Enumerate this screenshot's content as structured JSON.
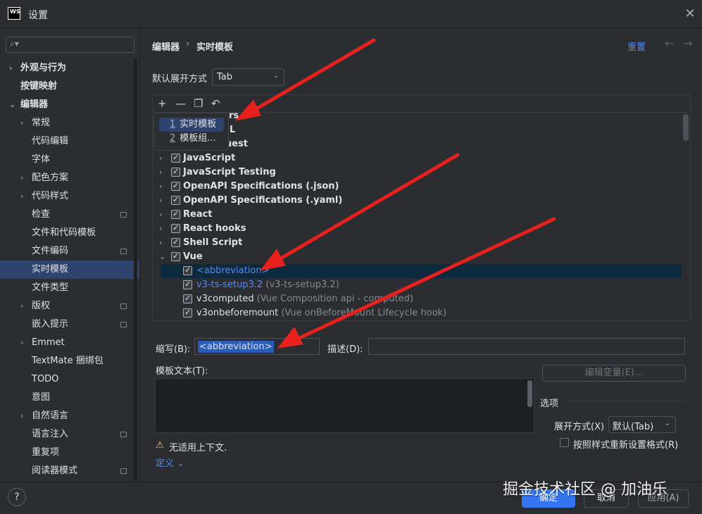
{
  "window": {
    "title": "设置",
    "logo": "WS"
  },
  "sidebar": {
    "search_placeholder": "",
    "items": [
      {
        "label": "外观与行为",
        "bold": true,
        "chevron": "›"
      },
      {
        "label": "按键映射",
        "bold": true,
        "chevron": ""
      },
      {
        "label": "编辑器",
        "bold": true,
        "chevron": "⌄"
      },
      {
        "label": "常规",
        "chevron": "›"
      },
      {
        "label": "代码编辑"
      },
      {
        "label": "字体"
      },
      {
        "label": "配色方案",
        "chevron": "›"
      },
      {
        "label": "代码样式",
        "chevron": "›"
      },
      {
        "label": "检查",
        "badge": true
      },
      {
        "label": "文件和代码模板"
      },
      {
        "label": "文件编码",
        "badge": true
      },
      {
        "label": "实时模板",
        "selected": true
      },
      {
        "label": "文件类型"
      },
      {
        "label": "版权",
        "chevron": "›",
        "badge": true
      },
      {
        "label": "嵌入提示",
        "badge": true
      },
      {
        "label": "Emmet",
        "chevron": "›"
      },
      {
        "label": "TextMate 捆绑包"
      },
      {
        "label": "TODO"
      },
      {
        "label": "意图"
      },
      {
        "label": "自然语言",
        "chevron": "›"
      },
      {
        "label": "语言注入",
        "badge": true
      },
      {
        "label": "重复项"
      },
      {
        "label": "阅读器模式",
        "badge": true
      }
    ]
  },
  "breadcrumb": {
    "parent": "编辑器",
    "separator": "›",
    "current": "实时模板"
  },
  "header": {
    "reset": "重置",
    "back_icon": "←",
    "forward_icon": "→"
  },
  "expand": {
    "label": "默认展开方式",
    "value": "Tab"
  },
  "toolbar": {
    "add_icon": "+",
    "remove_icon": "—",
    "copy_icon": "❐",
    "undo_icon": "↶"
  },
  "popup": {
    "items": [
      {
        "num": "1",
        "label": "实时模板",
        "selected": true
      },
      {
        "num": "2",
        "label": "模板组..."
      }
    ]
  },
  "tree": {
    "hidden_rows": [
      {
        "label": "rs",
        "bold": true
      },
      {
        "label": "L",
        "bold": true
      },
      {
        "label": "uest",
        "bold": true
      }
    ],
    "groups": [
      {
        "label": "JavaScript"
      },
      {
        "label": "JavaScript Testing"
      },
      {
        "label": "OpenAPI Specifications (.json)"
      },
      {
        "label": "OpenAPI Specifications (.yaml)"
      },
      {
        "label": "React"
      },
      {
        "label": "React hooks"
      },
      {
        "label": "Shell Script"
      },
      {
        "label": "Vue"
      }
    ],
    "children": [
      {
        "abbr": "<abbreviation>",
        "desc": "",
        "selected": true,
        "blue": true
      },
      {
        "abbr": "v3-ts-setup3.2",
        "desc": "(v3-ts-setup3.2)",
        "blue": true
      },
      {
        "abbr": "v3computed",
        "desc": "(Vue Composition api - computed)"
      },
      {
        "abbr": "v3onbeforemount",
        "desc": "(Vue onBeforeMount Lifecycle hook)"
      }
    ]
  },
  "form": {
    "abbr_label": "缩写(B):",
    "abbr_value": "<abbreviation>",
    "desc_label": "描述(D):",
    "desc_value": "",
    "template_label": "模板文本(T):",
    "edit_vars": "编辑变量(E)...",
    "options_label": "选项",
    "expand_with_label": "展开方式(X)",
    "expand_with_value": "默认(Tab)",
    "reformat_label": "按照样式重新设置格式(R)",
    "warning": "无适用上下文.",
    "define": "定义"
  },
  "footer": {
    "help": "?",
    "ok": "确定",
    "cancel": "取消",
    "apply": "应用(A)"
  },
  "watermark": "掘金技术社区 @ 加油乐",
  "colors": {
    "accent": "#3574f0",
    "selection": "#2e436e",
    "link": "#548af7",
    "arrow": "#e8201e"
  }
}
